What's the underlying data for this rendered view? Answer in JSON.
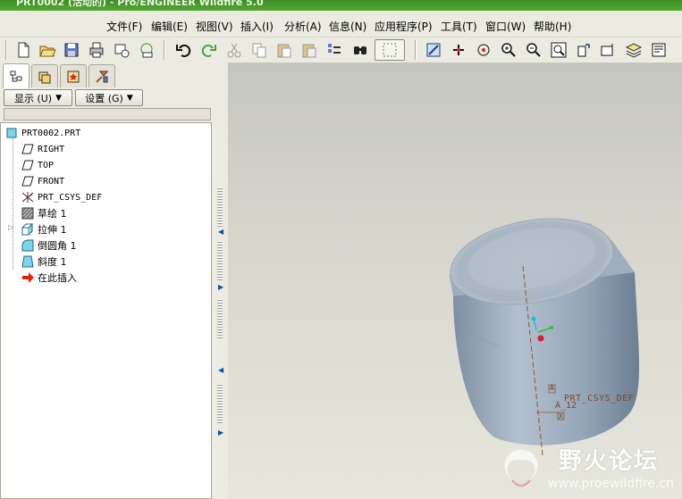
{
  "window": {
    "title": "PRT0002 (活动的) - Pro/ENGINEER Wildfire 5.0"
  },
  "menus": [
    {
      "label": "文件(F)"
    },
    {
      "label": "编辑(E)"
    },
    {
      "label": "视图(V)"
    },
    {
      "label": "插入(I)"
    },
    {
      "label": "分析(A)"
    },
    {
      "label": "信息(N)"
    },
    {
      "label": "应用程序(P)"
    },
    {
      "label": "工具(T)"
    },
    {
      "label": "窗口(W)"
    },
    {
      "label": "帮助(H)"
    }
  ],
  "toolbar": {
    "icons": [
      "new-icon",
      "open-icon",
      "save-icon",
      "print-icon",
      "email-icon",
      "email-link-icon",
      "undo-icon",
      "redo-icon",
      "cut-icon",
      "copy-icon",
      "paste-icon",
      "paste-special-icon",
      "regenerate-icon",
      "find-icon",
      "select-box-icon",
      "repaint-icon",
      "spin-center-icon",
      "orient-mode-icon",
      "zoom-in-icon",
      "zoom-out-icon",
      "refit-icon",
      "reorient-icon",
      "saved-views-icon",
      "layers-icon",
      "view-manager-icon"
    ]
  },
  "model_tree": {
    "tab_icons": [
      "model-tree-tab-icon",
      "folder-browser-tab-icon",
      "favorites-tab-icon",
      "connections-tab-icon"
    ],
    "show_button": "显示 (U)",
    "settings_button": "设置 (G)",
    "root": "PRT0002.PRT",
    "items": [
      {
        "label": "RIGHT",
        "icon": "datum-plane-icon",
        "mono": true
      },
      {
        "label": "TOP",
        "icon": "datum-plane-icon",
        "mono": true
      },
      {
        "label": "FRONT",
        "icon": "datum-plane-icon",
        "mono": true
      },
      {
        "label": "PRT_CSYS_DEF",
        "icon": "csys-icon",
        "mono": true
      },
      {
        "label": "草绘 1",
        "icon": "sketch-icon",
        "mono": false
      },
      {
        "label": "拉伸 1",
        "icon": "extrude-icon",
        "mono": false
      },
      {
        "label": "倒圆角 1",
        "icon": "round-icon",
        "mono": false
      },
      {
        "label": "斜度 1",
        "icon": "draft-icon",
        "mono": false
      },
      {
        "label": "在此插入",
        "icon": "insert-here-arrow-icon",
        "mono": false
      }
    ]
  },
  "viewport": {
    "csys_label": "PRT_CSYS_DEF",
    "axis_label": "A_12",
    "small_label_1": "A",
    "small_label_2": "X"
  },
  "watermark": {
    "title": "野火论坛",
    "url": "www.proewildfire.cn"
  }
}
